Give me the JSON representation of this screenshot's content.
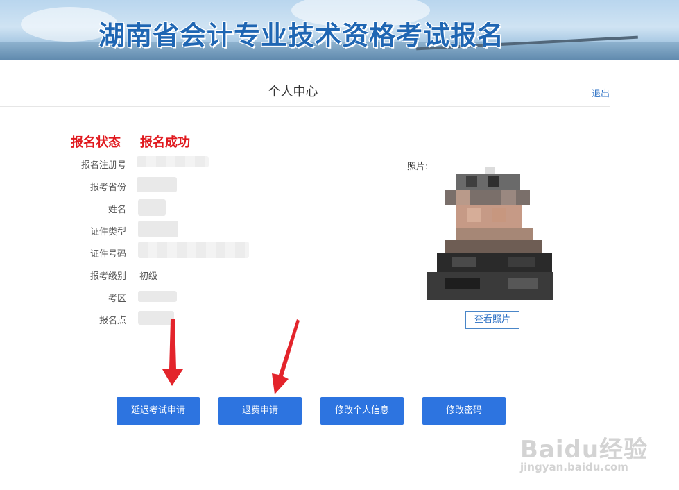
{
  "header": {
    "title": "湖南省会计专业技术资格考试报名"
  },
  "page": {
    "heading": "个人中心",
    "logout_label": "退出"
  },
  "status": {
    "label": "报名状态",
    "value": "报名成功"
  },
  "fields": [
    {
      "label": "报名注册号",
      "value": ""
    },
    {
      "label": "报考省份",
      "value": ""
    },
    {
      "label": "姓名",
      "value": ""
    },
    {
      "label": "证件类型",
      "value": ""
    },
    {
      "label": "证件号码",
      "value": ""
    },
    {
      "label": "报考级别",
      "value": "初级"
    },
    {
      "label": "考区",
      "value": ""
    },
    {
      "label": "报名点",
      "value": ""
    }
  ],
  "photo": {
    "label": "照片:",
    "view_button": "查看照片"
  },
  "actions": {
    "postpone": "延迟考试申请",
    "refund": "退费申请",
    "edit_info": "修改个人信息",
    "change_password": "修改密码"
  },
  "watermark": {
    "brand": "Baidu经验",
    "url": "jingyan.baidu.com"
  },
  "colors": {
    "accent_blue": "#2d74e0",
    "status_red": "#e0191e",
    "title_blue": "#1f66b3",
    "annotation_arrow": "#e3242b"
  }
}
